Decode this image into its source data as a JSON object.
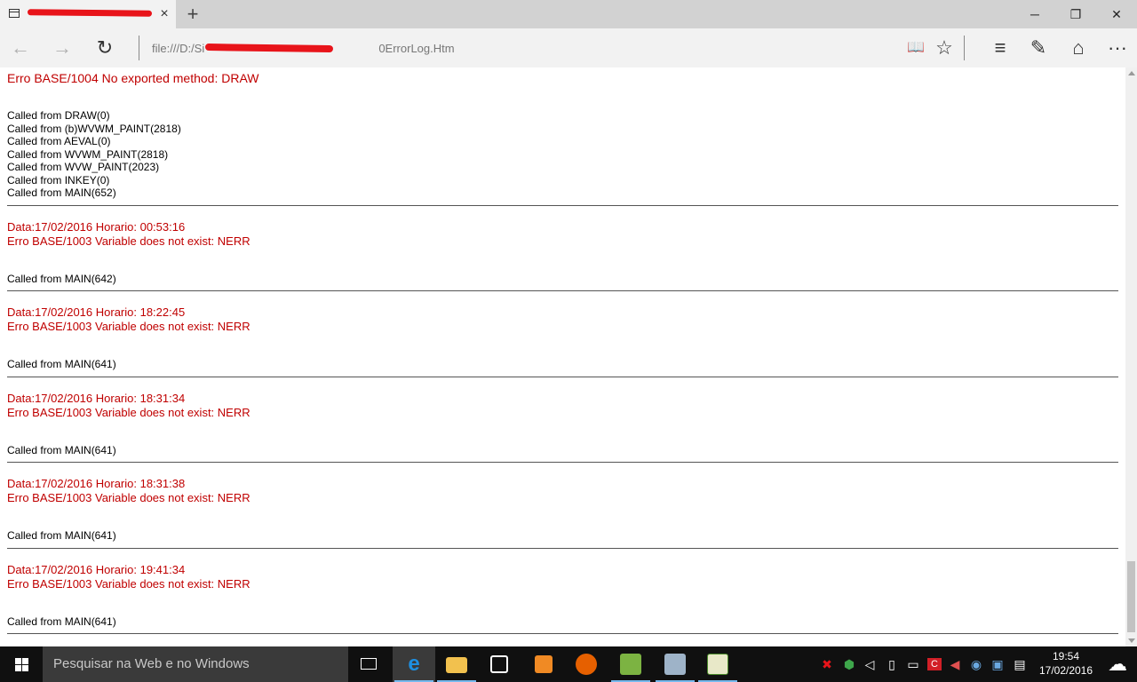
{
  "browser": {
    "tab": {
      "title": ""
    },
    "address": "file:///D:/Si                0ErrorLog.Htm",
    "icons": {
      "tab": "page-icon",
      "close": "×",
      "new_tab": "+",
      "minimize": "─",
      "restore": "❐",
      "win_close": "✕",
      "back": "←",
      "forward": "→",
      "refresh": "↻",
      "reading": "📖",
      "favorite": "☆",
      "hub": "≡",
      "note": "✎",
      "share": "⌂",
      "more": "···"
    }
  },
  "log": {
    "first_error": "Erro BASE/1004 No exported method: DRAW",
    "first_calls": [
      "Called from DRAW(0)",
      "Called from (b)WVWM_PAINT(2818)",
      "Called from AEVAL(0)",
      "Called from WVWM_PAINT(2818)",
      "Called from WVW_PAINT(2023)",
      "Called from INKEY(0)",
      "Called from MAIN(652)"
    ],
    "entries": [
      {
        "date": "Data:17/02/2016 Horario: 00:53:16",
        "error": "Erro BASE/1003 Variable does not exist: NERR",
        "call": "Called from MAIN(642)"
      },
      {
        "date": "Data:17/02/2016 Horario: 18:22:45",
        "error": "Erro BASE/1003 Variable does not exist: NERR",
        "call": "Called from MAIN(641)"
      },
      {
        "date": "Data:17/02/2016 Horario: 18:31:34",
        "error": "Erro BASE/1003 Variable does not exist: NERR",
        "call": "Called from MAIN(641)"
      },
      {
        "date": "Data:17/02/2016 Horario: 18:31:38",
        "error": "Erro BASE/1003 Variable does not exist: NERR",
        "call": "Called from MAIN(641)"
      },
      {
        "date": "Data:17/02/2016 Horario: 19:41:34",
        "error": "Erro BASE/1003 Variable does not exist: NERR",
        "call": "Called from MAIN(641)"
      }
    ]
  },
  "taskbar": {
    "search_placeholder": "Pesquisar na Web e no Windows",
    "clock_time": "19:54",
    "clock_date": "17/02/2016",
    "apps": [
      "task-view-icon",
      "edge-icon",
      "file-explorer-icon",
      "store-icon",
      "media-player-icon",
      "firefox-icon",
      "app-green-icon",
      "network-app-icon",
      "chart-app-icon"
    ],
    "tray": [
      "security-alert-icon",
      "green-shield-icon",
      "audio-icon",
      "usb-icon",
      "network-icon",
      "antivirus-icon",
      "volume-icon",
      "language-icon",
      "storage-icon",
      "notification-icon"
    ],
    "colors": {
      "accent": "#76b9ed",
      "error_text": "#c00000",
      "redaction": "#e8141a"
    }
  }
}
